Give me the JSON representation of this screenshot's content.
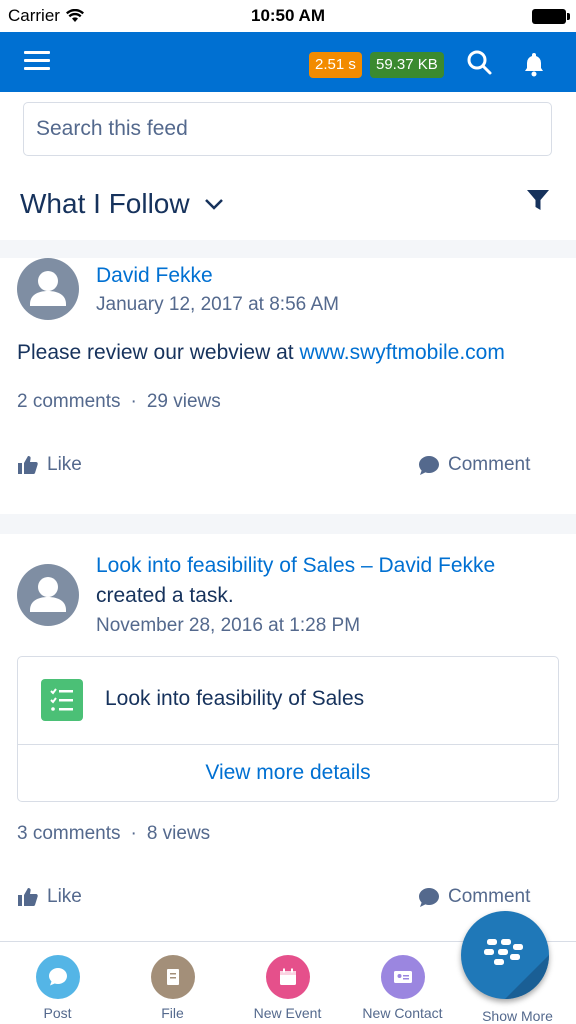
{
  "status_bar": {
    "carrier": "Carrier",
    "time": "10:50 AM"
  },
  "header": {
    "load_time": "2.51 s",
    "page_size": "59.37 KB"
  },
  "search": {
    "placeholder": "Search this feed"
  },
  "feed": {
    "title": "What I Follow"
  },
  "posts": [
    {
      "author": "David Fekke",
      "timestamp": "January 12, 2017 at 8:56 AM",
      "body_prefix": "Please review our webview at ",
      "body_link": "www.swyftmobile.com",
      "comments": "2 comments",
      "views": "29 views",
      "like_label": "Like",
      "comment_label": "Comment"
    },
    {
      "title_link": "Look into feasibility of Sales – David Fekke",
      "action_text": "created a task.",
      "timestamp": "November 28, 2016 at 1:28 PM",
      "task_title": "Look into feasibility of Sales",
      "task_details_label": "View more details",
      "comments": "3 comments",
      "views": "8 views",
      "like_label": "Like",
      "comment_label": "Comment"
    }
  ],
  "tabbar": {
    "items": [
      {
        "label": "Post",
        "color": "#54b5e6"
      },
      {
        "label": "File",
        "color": "#a38f79"
      },
      {
        "label": "New Event",
        "color": "#e5508b"
      },
      {
        "label": "New Contact",
        "color": "#9b86e0"
      },
      {
        "label": "Show More"
      }
    ]
  },
  "colors": {
    "brand_blue": "#0070d2",
    "text_dark": "#16325c",
    "text_muted": "#54698d"
  }
}
